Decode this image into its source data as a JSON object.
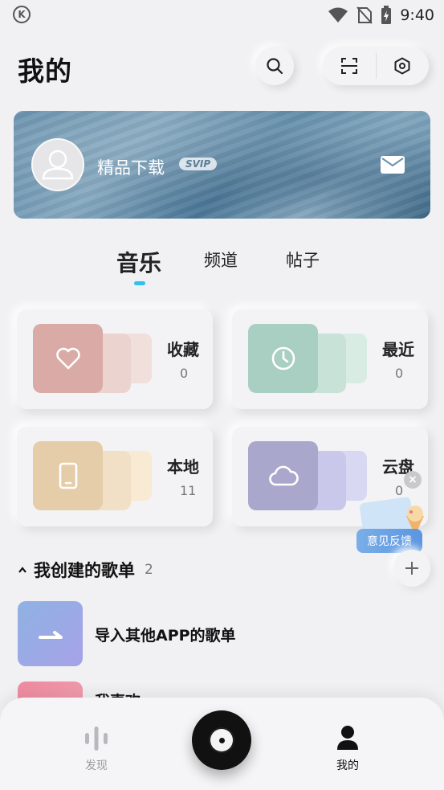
{
  "status_bar": {
    "left_icon": "k-circle-icon",
    "icons": [
      "wifi-icon",
      "no-sim-icon",
      "battery-charging-icon"
    ],
    "time": "9:40"
  },
  "header": {
    "title": "我的",
    "search_icon": "search-icon",
    "scan_icon": "scan-icon",
    "settings_icon": "hexagon-settings-icon"
  },
  "profile": {
    "username": "精品下载",
    "vip_badge": "SVIP",
    "avatar_icon": "user-avatar-icon",
    "mail_icon": "mail-icon"
  },
  "tabs": [
    {
      "label": "音乐",
      "active": true
    },
    {
      "label": "频道",
      "active": false
    },
    {
      "label": "帖子",
      "active": false
    }
  ],
  "accent_color": "#2ec3ef",
  "quick_cards": [
    {
      "label": "收藏",
      "count": "0",
      "icon": "heart-icon",
      "colors": [
        "#d9aaa6",
        "#ebd3cf",
        "#f1dfdc"
      ]
    },
    {
      "label": "最近",
      "count": "0",
      "icon": "clock-icon",
      "colors": [
        "#a8cfc1",
        "#c8e2d8",
        "#d8ece4"
      ]
    },
    {
      "label": "本地",
      "count": "11",
      "icon": "phone-icon",
      "colors": [
        "#e5cda9",
        "#f1e0c5",
        "#f8ead3"
      ]
    },
    {
      "label": "云盘",
      "count": "0",
      "icon": "cloud-icon",
      "colors": [
        "#a9a8cc",
        "#c9c8ea",
        "#d8d8f2"
      ]
    }
  ],
  "feedback": {
    "label": "意见反馈"
  },
  "playlists_section": {
    "title": "我创建的歌单",
    "count": "2",
    "items": [
      {
        "title": "导入其他APP的歌单",
        "cover_icon": "import-arrow-icon"
      },
      {
        "title": "我喜欢"
      }
    ]
  },
  "bottom_nav": {
    "items": [
      {
        "label": "发现",
        "icon": "equalizer-icon",
        "active": false
      },
      {
        "label": "",
        "icon": "vinyl-disc-icon"
      },
      {
        "label": "我的",
        "icon": "person-icon",
        "active": true
      }
    ]
  }
}
